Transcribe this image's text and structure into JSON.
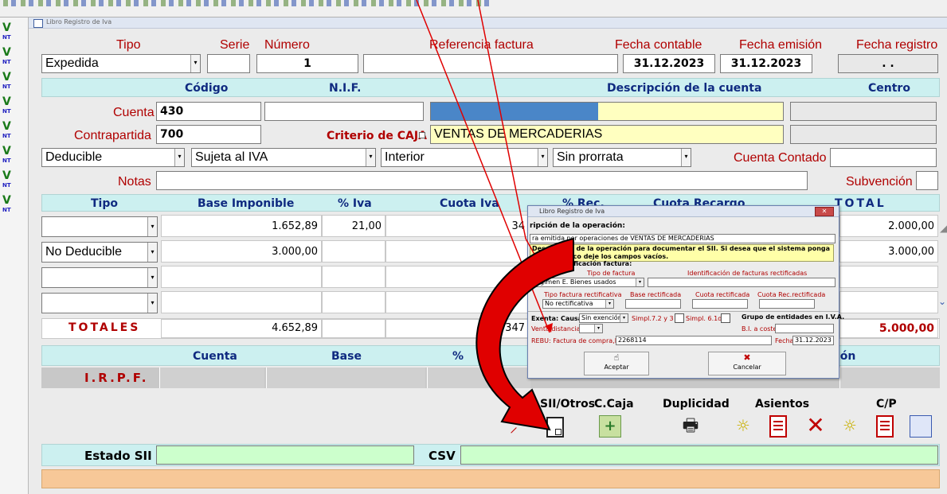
{
  "window": {
    "title": "Libro Registro de Iva"
  },
  "sidebar": {
    "items": [
      {
        "top": "V",
        "sub": "NT"
      },
      {
        "top": "V",
        "sub": "NT"
      },
      {
        "top": "V",
        "sub": "NT"
      },
      {
        "top": "V",
        "sub": "NT"
      },
      {
        "top": "V",
        "sub": "NT"
      },
      {
        "top": "V",
        "sub": "NT"
      },
      {
        "top": "V",
        "sub": "NT"
      },
      {
        "top": "V",
        "sub": "NT"
      }
    ]
  },
  "header": {
    "tipo_label": "Tipo",
    "serie_label": "Serie",
    "numero_label": "Número",
    "referencia_label": "Referencia factura",
    "fecha_contable_label": "Fecha contable",
    "fecha_emision_label": "Fecha emisión",
    "fecha_registro_label": "Fecha registro",
    "tipo_value": "Expedida",
    "serie_value": "",
    "numero_value": "1",
    "referencia_value": "",
    "fecha_contable_value": "31.12.2023",
    "fecha_emision_value": "31.12.2023",
    "fecha_registro_value": ". ."
  },
  "accounts": {
    "codigo_header": "Código",
    "nif_header": "N.I.F.",
    "descripcion_header": "Descripción de la cuenta",
    "centro_header": "Centro",
    "cuenta_label": "Cuenta",
    "cuenta_value": "430",
    "contrapartida_label": "Contrapartida",
    "contrapartida_value": "700",
    "criterio_caja_label": "Criterio de CAJA",
    "contrapartida_descripcion": "VENTAS DE MERCADERIAS"
  },
  "selects": {
    "deducible": "Deducible",
    "sujeta": "Sujeta al IVA",
    "interior": "Interior",
    "prorrata": "Sin prorrata",
    "cuenta_contado_label": "Cuenta Contado",
    "notas_label": "Notas",
    "subvencion_label": "Subvención"
  },
  "iva_table": {
    "headers": {
      "tipo": "Tipo",
      "base": "Base Imponible",
      "pct_iva": "% Iva",
      "cuota_iva": "Cuota Iva",
      "pct_rec": "% Rec.",
      "cuota_recargo": "Cuota Recargo",
      "total": "TOTAL"
    },
    "rows": [
      {
        "tipo": "",
        "base": "1.652,89",
        "pct_iva": "21,00",
        "cuota_iva": "34",
        "total": "2.000,00"
      },
      {
        "tipo": "No Deducible",
        "base": "3.000,00",
        "pct_iva": "",
        "cuota_iva": "",
        "total": "3.000,00"
      },
      {
        "tipo": "",
        "base": "",
        "pct_iva": "",
        "cuota_iva": "",
        "total": ""
      },
      {
        "tipo": "",
        "base": "",
        "pct_iva": "",
        "cuota_iva": "",
        "total": ""
      }
    ],
    "totales_label": "TOTALES",
    "totales_base": "4.652,89",
    "totales_cuota": "347",
    "totales_total": "5.000,00"
  },
  "irpf": {
    "cuenta_header": "Cuenta",
    "base_header": "Base",
    "pct_header": "%",
    "retencion_header": "ión",
    "label": "I.R.P.F."
  },
  "actions": {
    "sii_otros": "SII/Otros",
    "c_caja": "C.Caja",
    "duplicidad": "Duplicidad",
    "asientos": "Asientos",
    "cp": "C/P"
  },
  "status": {
    "estado_sii_label": "Estado SII",
    "csv_label": "CSV"
  },
  "dialog": {
    "title": "Libro Registro de Iva",
    "descripcion_label": "ripción de la operación:",
    "descripcion_value": "ra emitida por operaciones de VENTAS DE MERCADERIAS",
    "tooltip": "Descripción de la operación para documentar el SII. Si desea que el sistema ponga el automático deje los campos vacíos.",
    "identificacion_label": "Datos identificación factura:",
    "tipo_factura_label": "Tipo de factura",
    "tipo_factura_value": "Régimen E. Bienes usados",
    "identificacion_rectificadas_label": "Identificación de facturas rectificadas",
    "tipo_rectificativa_label": "Tipo factura rectificativa",
    "tipo_rectificativa_value": "No rectificativa",
    "base_rectificada_label": "Base rectificada",
    "cuota_rectificada_label": "Cuota rectificada",
    "cuota_rec_rectificada_label": "Cuota Rec.rectificada",
    "exenta_label": "Exenta: Causa",
    "exenta_value": "Sin exención",
    "simpl_73_label": "Simpl.7.2 y 3",
    "simpl_61d_label": "Simpl. 6.1d",
    "grupo_label": "Grupo de entidades en I.V.A.",
    "venta_distancia_label": "Venta distancia",
    "bi_coste_label": "B.I. a coste",
    "rebu_label": "REBU: Factura de compra,Nº",
    "rebu_value": "2268114",
    "fecha_label": "Fecha",
    "fecha_value": "31.12.2023",
    "aceptar_label": "Aceptar",
    "cancelar_label": "Cancelar"
  }
}
